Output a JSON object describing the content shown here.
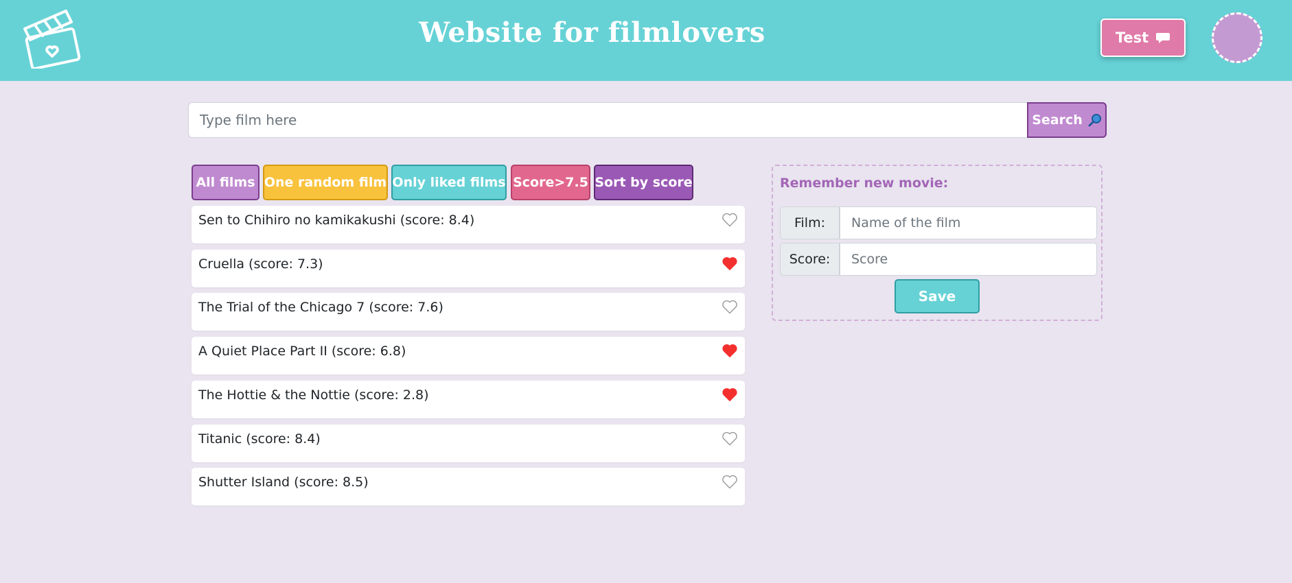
{
  "header": {
    "title": "Website for filmlovers",
    "logo_icon": "clapperboard-heart-icon",
    "test_button": {
      "label": "Test",
      "icon": "speech-bubble-icon"
    },
    "avatar_color": "#c49ad2"
  },
  "search": {
    "placeholder": "Type film here",
    "value": "",
    "button_label": "Search",
    "button_icon": "magnifier-icon"
  },
  "filters": [
    {
      "label": "All films",
      "bg": "#c08ad0",
      "border": "#7a3c8c"
    },
    {
      "label": "One random film",
      "bg": "#f9c23c",
      "border": "#d49a12"
    },
    {
      "label": "Only liked films",
      "bg": "#66d2d6",
      "border": "#2f9ea2"
    },
    {
      "label": "Score>7.5",
      "bg": "#e2678f",
      "border": "#b84168"
    },
    {
      "label": "Sort by score",
      "bg": "#9b59b6",
      "border": "#5e2a73"
    }
  ],
  "films": [
    {
      "text": "Sen to Chihiro no kamikakushi (score: 8.4)",
      "liked": false
    },
    {
      "text": "Cruella (score: 7.3)",
      "liked": true
    },
    {
      "text": "The Trial of the Chicago 7 (score: 7.6)",
      "liked": false
    },
    {
      "text": "A Quiet Place Part II (score: 6.8)",
      "liked": true
    },
    {
      "text": "The Hottie & the Nottie (score: 2.8)",
      "liked": true
    },
    {
      "text": "Titanic (score: 8.4)",
      "liked": false
    },
    {
      "text": "Shutter Island (score: 8.5)",
      "liked": false
    }
  ],
  "new_movie": {
    "title": "Remember new movie:",
    "film_label": "Film:",
    "film_placeholder": "Name of the film",
    "score_label": "Score:",
    "score_placeholder": "Score",
    "save_label": "Save"
  },
  "colors": {
    "header_bg": "#66d2d6",
    "page_bg": "#e9e4ef",
    "heart_liked": "#f4302f",
    "heart_empty": "#9a9a9a"
  }
}
